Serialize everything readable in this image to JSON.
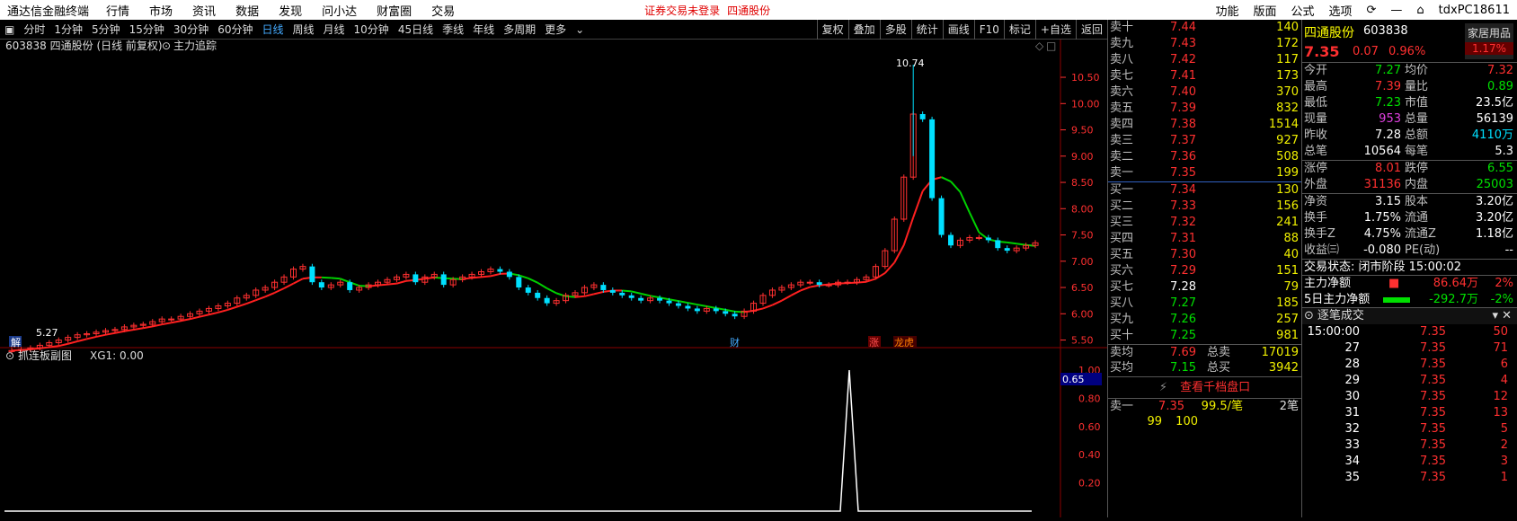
{
  "app_title": "通达信金融终端",
  "menu": [
    "行情",
    "市场",
    "资讯",
    "数据",
    "发现",
    "问小达",
    "财富圈",
    "交易"
  ],
  "alert": "证券交易未登录",
  "alert_stock": "四通股份",
  "menu_right": [
    "功能",
    "版面",
    "公式",
    "选项"
  ],
  "user": "tdxPC18611",
  "periods": [
    "分时",
    "1分钟",
    "5分钟",
    "15分钟",
    "30分钟",
    "60分钟",
    "日线",
    "周线",
    "月线",
    "10分钟",
    "45日线",
    "季线",
    "年线",
    "多周期",
    "更多"
  ],
  "active_period": "日线",
  "toolbar_right": [
    "复权",
    "叠加",
    "多股",
    "统计",
    "画线",
    "F10",
    "标记",
    "+自选",
    "返回"
  ],
  "chart_title": "603838 四通股份 (日线 前复权)",
  "indicator_name": "主力追踪",
  "price_axis": [
    "10.50",
    "10.00",
    "9.50",
    "9.00",
    "8.50",
    "8.00",
    "7.50",
    "7.00",
    "6.50",
    "6.00",
    "5.50"
  ],
  "high_label": "10.74",
  "low_label": "5.27",
  "events": {
    "jie": "解",
    "cai": "财",
    "zhang": "涨",
    "longhu": "龙虎"
  },
  "sub_title": "抓连板副图",
  "sub_value": "XG1: 0.00",
  "sub_axis": [
    "1.00",
    "0.80",
    "0.60",
    "0.40",
    "0.20"
  ],
  "sub_marker": "0.65",
  "colors": {
    "up": "#ff3030",
    "down": "#00e0ff",
    "ma_up": "#ff2020",
    "ma_down": "#00d000"
  },
  "quotes_sell": [
    {
      "label": "卖十",
      "price": "7.44",
      "vol": "140"
    },
    {
      "label": "卖九",
      "price": "7.43",
      "vol": "172"
    },
    {
      "label": "卖八",
      "price": "7.42",
      "vol": "117"
    },
    {
      "label": "卖七",
      "price": "7.41",
      "vol": "173"
    },
    {
      "label": "卖六",
      "price": "7.40",
      "vol": "370"
    },
    {
      "label": "卖五",
      "price": "7.39",
      "vol": "832"
    },
    {
      "label": "卖四",
      "price": "7.38",
      "vol": "1514"
    },
    {
      "label": "卖三",
      "price": "7.37",
      "vol": "927"
    },
    {
      "label": "卖二",
      "price": "7.36",
      "vol": "508"
    },
    {
      "label": "卖一",
      "price": "7.35",
      "vol": "199"
    }
  ],
  "quotes_buy": [
    {
      "label": "买一",
      "price": "7.34",
      "vol": "130"
    },
    {
      "label": "买二",
      "price": "7.33",
      "vol": "156"
    },
    {
      "label": "买三",
      "price": "7.32",
      "vol": "241"
    },
    {
      "label": "买四",
      "price": "7.31",
      "vol": "88"
    },
    {
      "label": "买五",
      "price": "7.30",
      "vol": "40"
    },
    {
      "label": "买六",
      "price": "7.29",
      "vol": "151"
    },
    {
      "label": "买七",
      "price": "7.28",
      "vol": "79"
    },
    {
      "label": "买八",
      "price": "7.27",
      "vol": "185"
    },
    {
      "label": "买九",
      "price": "7.26",
      "vol": "257"
    },
    {
      "label": "买十",
      "price": "7.25",
      "vol": "981"
    }
  ],
  "avg": {
    "sell_label": "卖均",
    "sell_price": "7.69",
    "sell_total_label": "总卖",
    "sell_total": "17019",
    "buy_label": "买均",
    "buy_price": "7.15",
    "buy_total_label": "总买",
    "buy_total": "3942"
  },
  "view_depth": "查看千档盘口",
  "bottom_sell": {
    "label": "卖一",
    "price": "7.35",
    "per": "99.5/笔",
    "count": "2笔"
  },
  "bottom_vals": [
    "99",
    "100"
  ],
  "stock": {
    "name": "四通股份",
    "code": "603838",
    "price": "7.35",
    "change": "0.07",
    "pct": "0.96%",
    "group": "家居用品",
    "group_pct": "1.17%"
  },
  "stats": [
    {
      "k": "今开",
      "v": "7.27",
      "vc": "green",
      "k2": "均价",
      "v2": "7.32",
      "v2c": "red"
    },
    {
      "k": "最高",
      "v": "7.39",
      "vc": "red",
      "k2": "量比",
      "v2": "0.89",
      "v2c": "green"
    },
    {
      "k": "最低",
      "v": "7.23",
      "vc": "green",
      "k2": "市值",
      "v2": "23.5亿",
      "v2c": "white"
    },
    {
      "k": "现量",
      "v": "953",
      "vc": "purple",
      "k2": "总量",
      "v2": "56139",
      "v2c": "white"
    },
    {
      "k": "昨收",
      "v": "7.28",
      "vc": "white",
      "k2": "总额",
      "v2": "4110万",
      "v2c": "cyan"
    },
    {
      "k": "总笔",
      "v": "10564",
      "vc": "white",
      "k2": "每笔",
      "v2": "5.3",
      "v2c": "white"
    }
  ],
  "stats2": [
    {
      "k": "涨停",
      "v": "8.01",
      "vc": "red",
      "k2": "跌停",
      "v2": "6.55",
      "v2c": "green"
    },
    {
      "k": "外盘",
      "v": "31136",
      "vc": "red",
      "k2": "内盘",
      "v2": "25003",
      "v2c": "green"
    }
  ],
  "stats3": [
    {
      "k": "净资",
      "v": "3.15",
      "k2": "股本",
      "v2": "3.20亿"
    },
    {
      "k": "换手",
      "v": "1.75%",
      "k2": "流通",
      "v2": "3.20亿"
    },
    {
      "k": "换手Z",
      "v": "4.75%",
      "k2": "流通Z",
      "v2": "1.18亿"
    },
    {
      "k": "收益㈢",
      "v": "-0.080",
      "k2": "PE(动)",
      "v2": "--"
    }
  ],
  "trade_state": "交易状态: 闭市阶段 15:00:02",
  "main_net": {
    "label": "主力净额",
    "value": "86.64万",
    "pct": "2%"
  },
  "main_net5": {
    "label": "5日主力净额",
    "value": "-292.7万",
    "pct": "-2%"
  },
  "ticks_title": "逐笔成交",
  "ticks": [
    {
      "t": "15:00:00",
      "p": "7.35",
      "v": "50"
    },
    {
      "t": "27",
      "p": "7.35",
      "v": "71"
    },
    {
      "t": "28",
      "p": "7.35",
      "v": "6"
    },
    {
      "t": "29",
      "p": "7.35",
      "v": "4"
    },
    {
      "t": "30",
      "p": "7.35",
      "v": "12"
    },
    {
      "t": "31",
      "p": "7.35",
      "v": "13"
    },
    {
      "t": "32",
      "p": "7.35",
      "v": "5"
    },
    {
      "t": "33",
      "p": "7.35",
      "v": "2"
    },
    {
      "t": "34",
      "p": "7.35",
      "v": "3"
    },
    {
      "t": "35",
      "p": "7.35",
      "v": "1"
    }
  ]
}
